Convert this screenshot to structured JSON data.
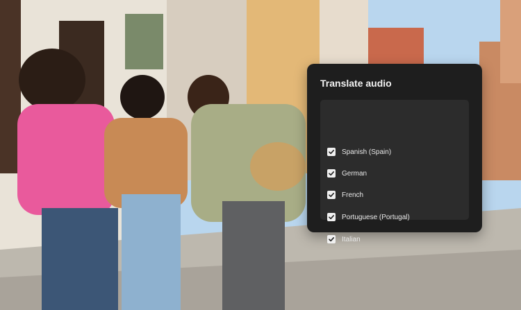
{
  "panel": {
    "title": "Translate audio",
    "languages": [
      {
        "label": "Spanish (Spain)",
        "checked": true
      },
      {
        "label": "German",
        "checked": true
      },
      {
        "label": "French",
        "checked": true
      },
      {
        "label": "Portuguese (Portugal)",
        "checked": true
      },
      {
        "label": "Italian",
        "checked": true
      }
    ]
  },
  "colors": {
    "panel_bg": "#1e1e1e",
    "list_bg": "#2c2c2c",
    "checkbox_fill": "#f0f0f0",
    "text": "#e8e8e8"
  }
}
